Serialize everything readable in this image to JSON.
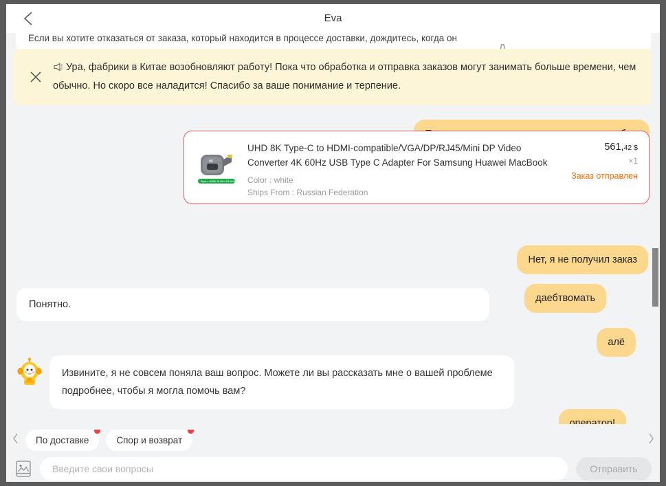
{
  "header": {
    "title": "Eva",
    "back_icon": "chevron-left-icon"
  },
  "announcement": {
    "close_icon": "close-icon",
    "megaphone_icon": "megaphone-icon",
    "text": "Ура, фабрики в Китае возобновляют работу! Пока что обработка и отправка заказов могут занимать больше времени, чем обычно. Но скоро все наладится! Спасибо за ваше понимание и терпение."
  },
  "clipped_top": {
    "text": "Если вы хотите отказаться от заказа, который находится в процессе доставки, дождитесь, когда он",
    "chip_glyph": "⌁"
  },
  "messages": [
    {
      "id": "user-1",
      "sender": "user",
      "text": "Продавец отправил посылку не тем способом"
    },
    {
      "id": "user-2",
      "sender": "user",
      "text": "Нет, я не получил заказ"
    },
    {
      "id": "user-3",
      "sender": "user",
      "text": "даебтвомать"
    },
    {
      "id": "bot-1",
      "sender": "bot",
      "text": "Понятно."
    },
    {
      "id": "user-4",
      "sender": "user",
      "text": "алё"
    },
    {
      "id": "bot-2",
      "sender": "bot",
      "text": "Извините, я не совсем поняла ваш вопрос. Можете ли вы рассказать мне о вашей проблеме подробнее, чтобы я могла помочь вам?"
    },
    {
      "id": "user-5",
      "sender": "user",
      "text": "оператор!"
    }
  ],
  "product_card": {
    "title": "UHD 8K Type-C to HDMI-compatible/VGA/DP/RJ45/Mini DP Video Converter 4K 60Hz USB Type C Adapter For Samsung Huawei MacBook",
    "color_attr": "Color : white",
    "ships_from_attr": "Ships From : Russian Federation",
    "price_main": "561,",
    "price_cents": "42 $",
    "quantity": "×1",
    "status": "Заказ отправлен",
    "status_color": "#ff6a00",
    "border_color": "#f5595e",
    "thumb_label": "Type-c HDMI  To Mini DP Adapter",
    "thumb_badge": "8K"
  },
  "quick_replies": {
    "prev_icon": "chevron-left-icon",
    "next_icon": "chevron-right-icon",
    "chips": [
      {
        "label": "По доставке",
        "has_dot": true
      },
      {
        "label": "Спор и возврат",
        "has_dot": true
      }
    ]
  },
  "composer": {
    "attach_icon": "image-upload-icon",
    "input_value": "",
    "input_placeholder": "Введите свои вопросы",
    "send_label": "Отправить"
  },
  "colors": {
    "user_bubble": "#fcd88e",
    "bot_bubble": "#ffffff",
    "banner_bg": "#fdf5d7",
    "page_bg": "#f2f3f4",
    "accent_red": "#fa3d3d"
  }
}
